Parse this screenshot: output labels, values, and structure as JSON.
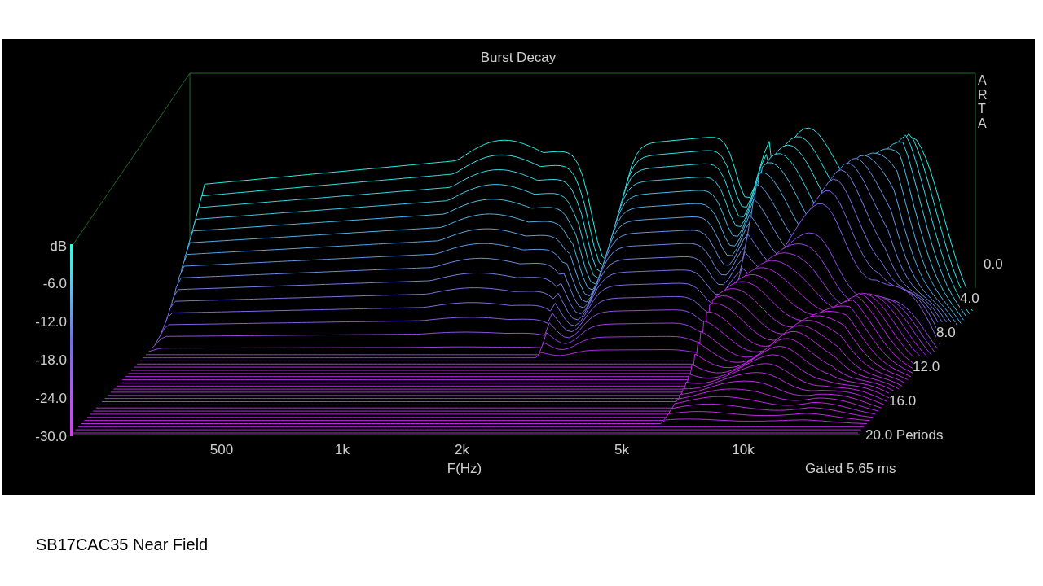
{
  "chart": {
    "title": "Burst Decay",
    "vendor_mark": "ARTA",
    "y_axis": {
      "unit": "dB",
      "ticks": [
        "-6.0",
        "-12.0",
        "-18.0",
        "-24.0",
        "-30.0"
      ]
    },
    "x_axis": {
      "label": "F(Hz)",
      "ticks": [
        "500",
        "1k",
        "2k",
        "5k",
        "10k"
      ]
    },
    "depth_axis": {
      "ticks": [
        "0.0",
        "4.0",
        "8.0",
        "12.0",
        "16.0",
        "20.0 Periods"
      ]
    },
    "gating": "Gated 5.65 ms"
  },
  "caption": "SB17CAC35 Near Field"
}
